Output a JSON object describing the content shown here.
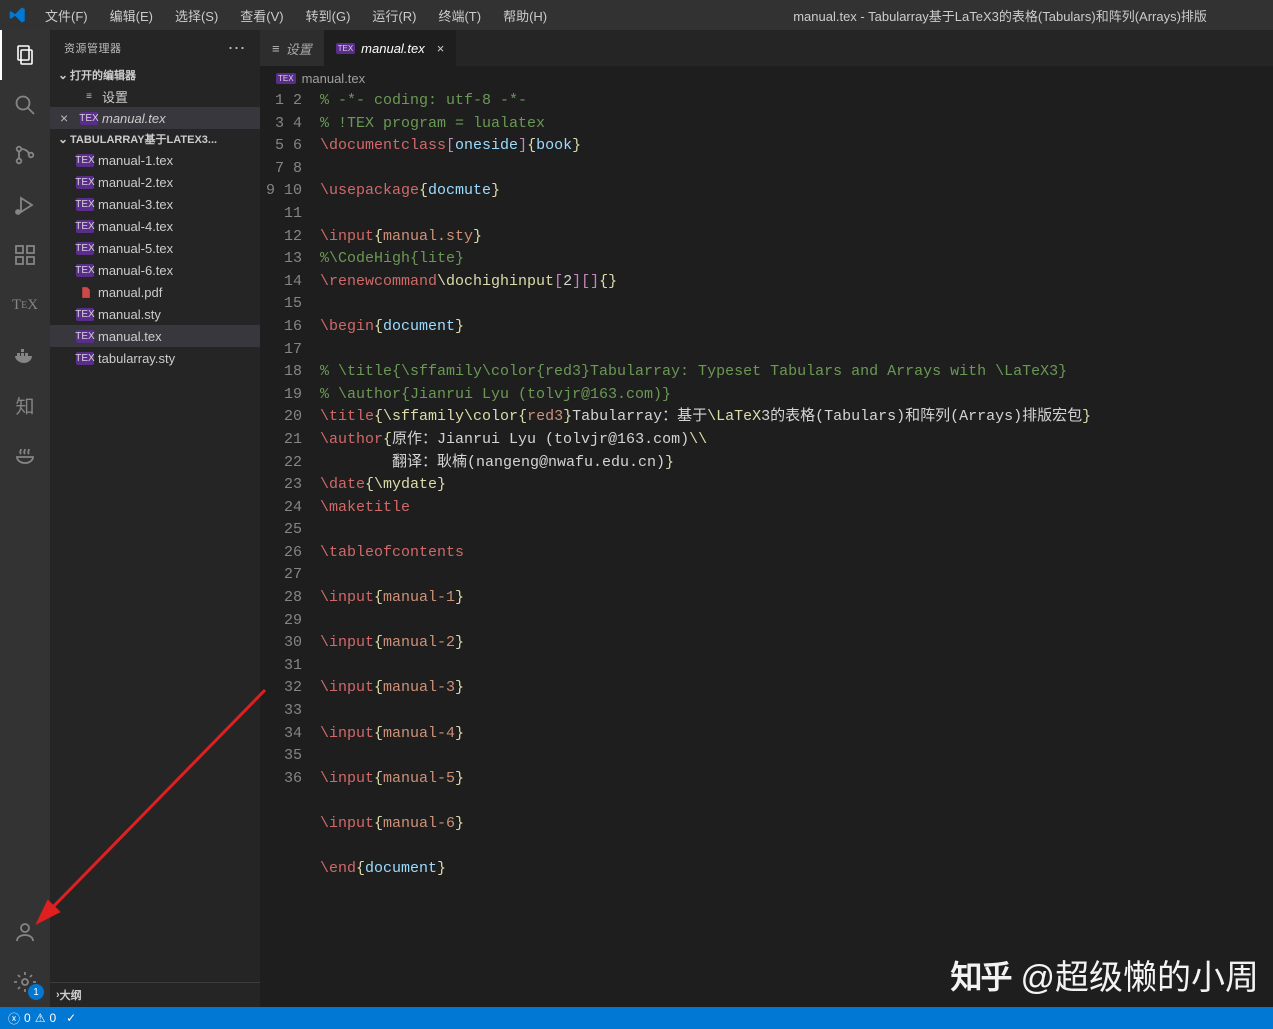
{
  "window_title": "manual.tex - Tabularray基于LaTeX3的表格(Tabulars)和阵列(Arrays)排版",
  "menus": [
    "文件(F)",
    "编辑(E)",
    "选择(S)",
    "查看(V)",
    "转到(G)",
    "运行(R)",
    "终端(T)",
    "帮助(H)"
  ],
  "sidebar": {
    "title": "资源管理器",
    "open_editors": "打开的编辑器",
    "open_items": [
      {
        "icon": "gear",
        "label": "设置"
      },
      {
        "icon": "tex",
        "label": "manual.tex",
        "active": true,
        "close": true
      }
    ],
    "folder_title": "TABULARRAY基于LATEX3...",
    "files": [
      {
        "icon": "tex",
        "label": "manual-1.tex"
      },
      {
        "icon": "tex",
        "label": "manual-2.tex"
      },
      {
        "icon": "tex",
        "label": "manual-3.tex"
      },
      {
        "icon": "tex",
        "label": "manual-4.tex"
      },
      {
        "icon": "tex",
        "label": "manual-5.tex"
      },
      {
        "icon": "tex",
        "label": "manual-6.tex"
      },
      {
        "icon": "pdf",
        "label": "manual.pdf"
      },
      {
        "icon": "tex",
        "label": "manual.sty"
      },
      {
        "icon": "tex",
        "label": "manual.tex",
        "active": true
      },
      {
        "icon": "tex",
        "label": "tabularray.sty"
      }
    ],
    "outline": "大纲"
  },
  "tabs": [
    {
      "icon": "gear",
      "label": "设置"
    },
    {
      "icon": "tex",
      "label": "manual.tex",
      "active": true,
      "close": true
    }
  ],
  "breadcrumb": "manual.tex",
  "code_lines": [
    [
      [
        "c-comment",
        "% -*- coding: utf-8 -*-"
      ]
    ],
    [
      [
        "c-comment",
        "% !TEX program = lualatex"
      ]
    ],
    [
      [
        "c-keyword",
        "\\documentclass"
      ],
      [
        "c-paren",
        "["
      ],
      [
        "c-var",
        "oneside"
      ],
      [
        "c-paren",
        "]"
      ],
      [
        "c-brace",
        "{"
      ],
      [
        "c-var",
        "book"
      ],
      [
        "c-brace",
        "}"
      ]
    ],
    [],
    [
      [
        "c-keyword",
        "\\usepackage"
      ],
      [
        "c-brace",
        "{"
      ],
      [
        "c-var",
        "docmute"
      ],
      [
        "c-brace",
        "}"
      ]
    ],
    [],
    [
      [
        "c-keyword",
        "\\input"
      ],
      [
        "c-brace",
        "{"
      ],
      [
        "c-lit",
        "manual.sty"
      ],
      [
        "c-brace",
        "}"
      ]
    ],
    [
      [
        "c-comment",
        "%\\CodeHigh{lite}"
      ]
    ],
    [
      [
        "c-keyword",
        "\\renewcommand"
      ],
      [
        "c-func",
        "\\dochighinput"
      ],
      [
        "c-paren",
        "["
      ],
      [
        "",
        "2"
      ],
      [
        "c-paren",
        "]"
      ],
      [
        "c-paren",
        "["
      ],
      [
        "c-paren",
        "]"
      ],
      [
        "c-brace",
        "{"
      ],
      [
        "c-brace",
        "}"
      ]
    ],
    [],
    [
      [
        "c-keyword",
        "\\begin"
      ],
      [
        "c-brace",
        "{"
      ],
      [
        "c-var",
        "document"
      ],
      [
        "c-brace",
        "}"
      ]
    ],
    [],
    [
      [
        "c-comment",
        "% \\title{\\sffamily\\color{red3}Tabularray: Typeset Tabulars and Arrays with \\LaTeX3}"
      ]
    ],
    [
      [
        "c-comment",
        "% \\author{Jianrui Lyu (tolvjr@163.com)}"
      ]
    ],
    [
      [
        "c-keyword",
        "\\title"
      ],
      [
        "c-brace",
        "{"
      ],
      [
        "c-func",
        "\\sffamily\\color"
      ],
      [
        "c-brace",
        "{"
      ],
      [
        "c-lit",
        "red3"
      ],
      [
        "c-brace",
        "}"
      ],
      [
        "",
        "Tabularray：基于"
      ],
      [
        "c-func",
        "\\LaTeX"
      ],
      [
        "",
        "3的表格(Tabulars)和阵列(Arrays)排版宏包"
      ],
      [
        "c-brace",
        "}"
      ]
    ],
    [
      [
        "c-keyword",
        "\\author"
      ],
      [
        "c-brace",
        "{"
      ],
      [
        "",
        "原作：Jianrui Lyu (tolvjr@163.com)"
      ],
      [
        "c-func",
        "\\\\"
      ]
    ],
    [
      [
        "",
        "        翻译：耿楠(nangeng@nwafu.edu.cn)"
      ],
      [
        "c-brace",
        "}"
      ]
    ],
    [
      [
        "c-keyword",
        "\\date"
      ],
      [
        "c-brace",
        "{"
      ],
      [
        "c-func",
        "\\mydate"
      ],
      [
        "c-brace",
        "}"
      ]
    ],
    [
      [
        "c-keyword",
        "\\maketitle"
      ]
    ],
    [],
    [
      [
        "c-keyword",
        "\\tableofcontents"
      ]
    ],
    [],
    [
      [
        "c-keyword",
        "\\input"
      ],
      [
        "c-brace",
        "{"
      ],
      [
        "c-lit",
        "manual-1"
      ],
      [
        "c-brace",
        "}"
      ]
    ],
    [],
    [
      [
        "c-keyword",
        "\\input"
      ],
      [
        "c-brace",
        "{"
      ],
      [
        "c-lit",
        "manual-2"
      ],
      [
        "c-brace",
        "}"
      ]
    ],
    [],
    [
      [
        "c-keyword",
        "\\input"
      ],
      [
        "c-brace",
        "{"
      ],
      [
        "c-lit",
        "manual-3"
      ],
      [
        "c-brace",
        "}"
      ]
    ],
    [],
    [
      [
        "c-keyword",
        "\\input"
      ],
      [
        "c-brace",
        "{"
      ],
      [
        "c-lit",
        "manual-4"
      ],
      [
        "c-brace",
        "}"
      ]
    ],
    [],
    [
      [
        "c-keyword",
        "\\input"
      ],
      [
        "c-brace",
        "{"
      ],
      [
        "c-lit",
        "manual-5"
      ],
      [
        "c-brace",
        "}"
      ]
    ],
    [],
    [
      [
        "c-keyword",
        "\\input"
      ],
      [
        "c-brace",
        "{"
      ],
      [
        "c-lit",
        "manual-6"
      ],
      [
        "c-brace",
        "}"
      ]
    ],
    [],
    [
      [
        "c-keyword",
        "\\end"
      ],
      [
        "c-brace",
        "{"
      ],
      [
        "c-var",
        "document"
      ],
      [
        "c-brace",
        "}"
      ]
    ],
    []
  ],
  "status": {
    "err": "0",
    "warn": "0"
  },
  "settings_badge": "1",
  "watermark": "@超级懒的小周"
}
